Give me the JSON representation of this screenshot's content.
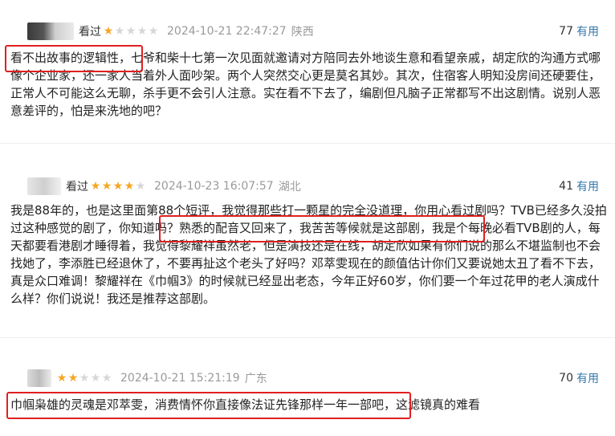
{
  "reviews": [
    {
      "action": "看过",
      "stars": 1,
      "time": "2024-10-21 22:47:27",
      "location": "陕西",
      "useful_count": "77",
      "useful_label": "有用",
      "content": "看不出故事的逻辑性，七爷和柴十七第一次见面就邀请对方陪同去外地谈生意和看望亲戚，胡定欣的沟通方式哪像个企业家，还一家人当着外人面吵架。两个人突然交心更是莫名其妙。其次，住宿客人明知没房间还硬要住，正常人不可能这么无聊，杀手更不会引人注意。实在看不下去了，编剧但凡脑子正常都写不出这剧情。说别人恶意差评的，怕是来洗地的吧？"
    },
    {
      "action": "看过",
      "stars": 4,
      "time": "2024-10-23 16:07:57",
      "location": "湖北",
      "useful_count": "41",
      "useful_label": "有用",
      "content": "我是88年的，也是这里面第88个短评，我觉得那些打一颗星的完全没道理，你用心看过剧吗？TVB已经多久没拍过这种感觉的剧了，你知道吗？熟悉的配音又回来了，我苦苦等候就是这部剧，我是个每晚必看TVB剧的人，每天都要看港剧才睡得着，我觉得黎耀祥虽然老，但是演技还是在线，胡定欣如果有你们说的那么不堪监制也不会找她了，李添胜已经退休了，不要再扯这个老头了好吗？邓萃雯现在的颜值估计你们又要说她太丑了看不下去，真是众口难调！黎耀祥在《巾帼3》的时候就已经显出老态，今年正好60岁，你们要一个年过花甲的老人演成什么样？你们说说！我还是推荐这部剧。"
    },
    {
      "action": "",
      "stars": 2,
      "time": "2024-10-21 15:21:19",
      "location": "广东",
      "useful_count": "70",
      "useful_label": "有用",
      "content": "巾帼枭雄的灵魂是邓萃雯，消费情怀你直接像法证先锋那样一年一部吧，这滤镜真的难看"
    }
  ],
  "colors": {
    "star_on": "#f5a623",
    "star_off": "#d6d6d6",
    "link": "#3377aa",
    "highlight": "#e02020",
    "meta_gray": "#9a9a9a"
  }
}
